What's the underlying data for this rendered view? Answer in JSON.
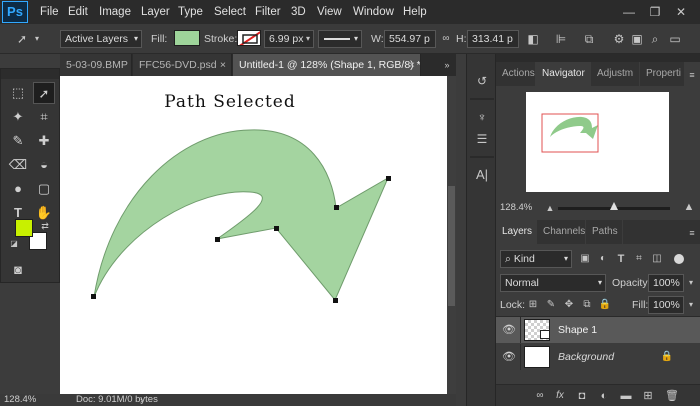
{
  "app": {
    "logo": "Ps"
  },
  "menu": [
    "File",
    "Edit",
    "Image",
    "Layer",
    "Type",
    "Select",
    "Filter",
    "3D",
    "View",
    "Window",
    "Help"
  ],
  "options_bar": {
    "mode_select": "Active Layers",
    "fill_label": "Fill:",
    "fill_color": "#9ed49a",
    "stroke_label": "Stroke:",
    "stroke_width": "6.99 px",
    "w_label": "W:",
    "w_value": "554.97 p",
    "h_label": "H:",
    "h_value": "313.41 p"
  },
  "doc_tabs": [
    {
      "label": "5-03-09.BMP",
      "active": false
    },
    {
      "label": "FFC56-DVD.psd",
      "active": false
    },
    {
      "label": "Untitled-1 @ 128% (Shape 1, RGB/8) *",
      "active": true
    }
  ],
  "canvas": {
    "heading": "Path Selected",
    "shape_fill": "#a4d4a0",
    "shape_stroke": "#6f9c6c"
  },
  "toolbox": {
    "foreground_color": "#c8f000",
    "background_color": "#ffffff"
  },
  "status": {
    "zoom": "128.4%",
    "doc_info": "Doc: 9.01M/0 bytes"
  },
  "navigator": {
    "tabs": [
      "Actions",
      "Navigator",
      "Adjustm",
      "Properti"
    ],
    "active_tab": "Navigator",
    "zoom": "128.4%"
  },
  "layers_panel": {
    "tabs": [
      "Layers",
      "Channels",
      "Paths"
    ],
    "active_tab": "Layers",
    "filter_kind": "Kind",
    "blend_mode": "Normal",
    "opacity_label": "Opacity:",
    "opacity": "100%",
    "lock_label": "Lock:",
    "fill_label": "Fill:",
    "fill": "100%",
    "layers": [
      {
        "name": "Shape 1",
        "selected": true
      },
      {
        "name": "Background",
        "selected": false
      }
    ],
    "footer_icons": [
      "link-icon",
      "fx-icon",
      "mask-icon",
      "adjustment-icon",
      "group-icon",
      "new-layer-icon",
      "trash-icon"
    ]
  }
}
